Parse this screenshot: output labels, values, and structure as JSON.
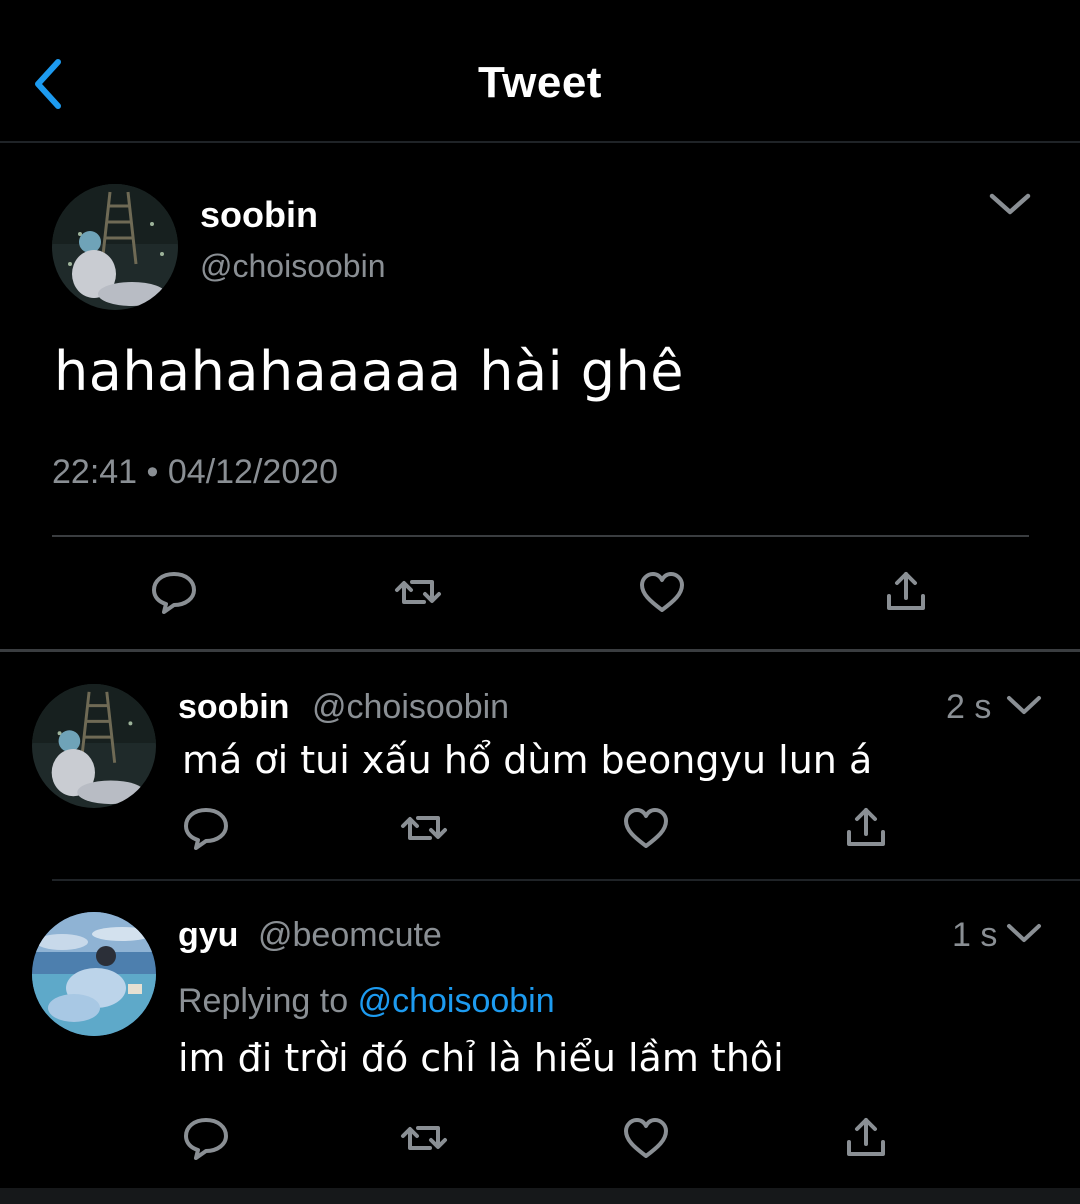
{
  "header": {
    "title": "Tweet"
  },
  "main_tweet": {
    "name": "soobin",
    "handle": "@choisoobin",
    "text": "hahahahaaaaa hài ghê",
    "timestamp": "22:41 • 04/12/2020"
  },
  "replies": [
    {
      "name": "soobin",
      "handle": "@choisoobin",
      "time": "2 s",
      "text": "má ơi tui xấu hổ dùm beongyu lun á"
    },
    {
      "name": "gyu",
      "handle": "@beomcute",
      "time": "1 s",
      "replying_prefix": "Replying to",
      "replying_to": "@choisoobin",
      "text": "im đi trời đó chỉ là hiểu lầm thôi"
    }
  ],
  "icons": {
    "back": "chevron-left-icon",
    "more": "chevron-down-icon",
    "reply": "speech-bubble-icon",
    "retweet": "retweet-icon",
    "like": "heart-icon",
    "share": "share-icon"
  },
  "colors": {
    "background": "#000000",
    "text": "#ffffff",
    "secondary": "#8a8f94",
    "accent": "#1d9bf0"
  }
}
